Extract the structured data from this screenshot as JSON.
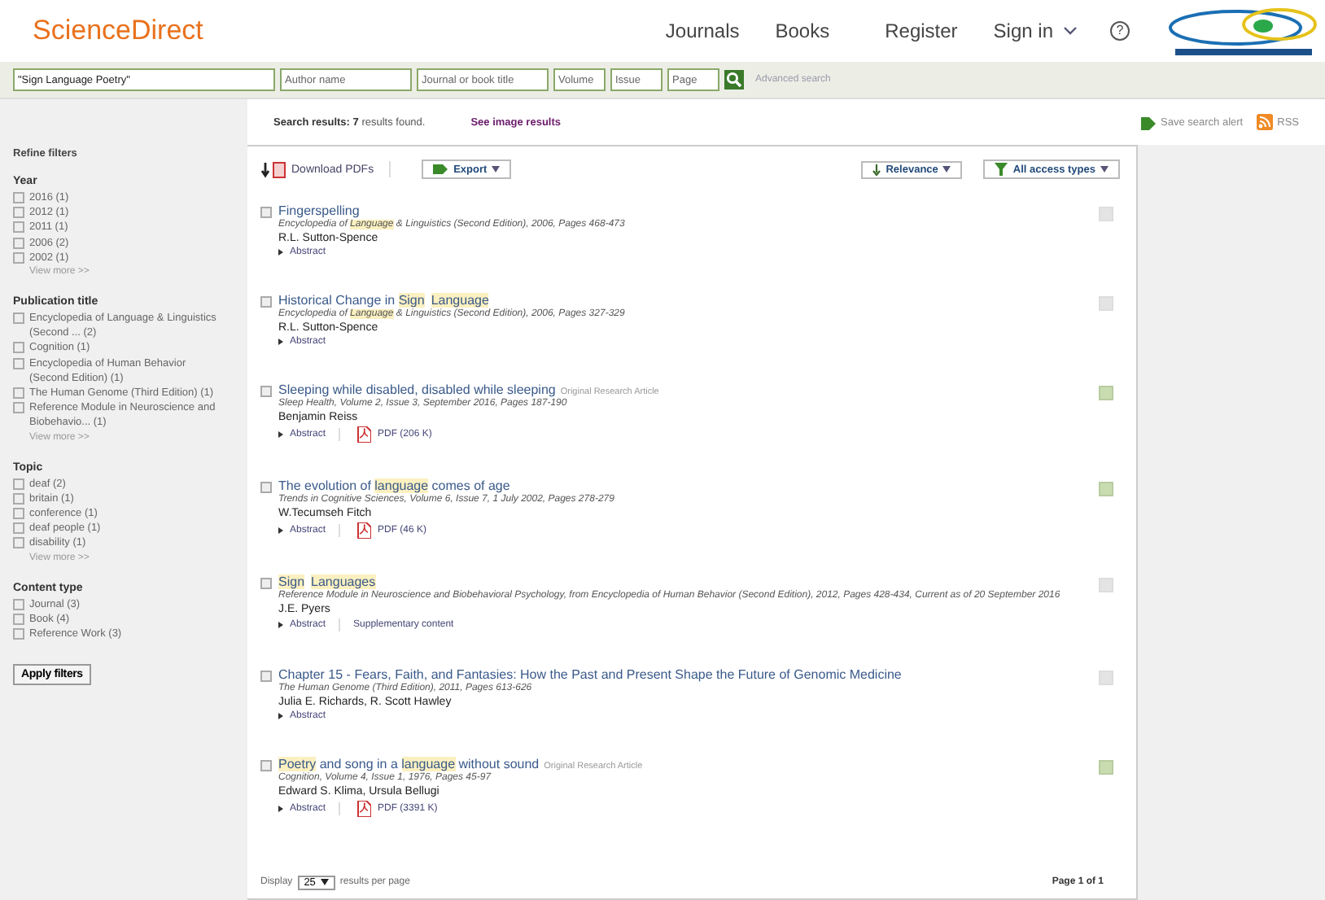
{
  "header": {
    "brand": "ScienceDirect",
    "nav": [
      "Journals",
      "Books"
    ],
    "register": "Register",
    "sign_in": "Sign in",
    "help": "?"
  },
  "search": {
    "fields": [
      {
        "kind": "terms",
        "value": "\"Sign Language Poetry\""
      },
      {
        "kind": "author",
        "placeholder": "Author name"
      },
      {
        "kind": "source",
        "placeholder": "Journal or book title"
      },
      {
        "kind": "small",
        "placeholder": "Volume"
      },
      {
        "kind": "small",
        "placeholder": "Issue"
      },
      {
        "kind": "small",
        "placeholder": "Page"
      }
    ],
    "advanced": "Advanced search"
  },
  "summary": {
    "label": "Search results:",
    "count": "7",
    "suffix": "results found.",
    "image_link": "See image results"
  },
  "alerts": {
    "save": "Save search alert",
    "rss": "RSS"
  },
  "filters": {
    "title": "Refine filters",
    "groups": [
      {
        "title": "Year",
        "items": [
          {
            "label": "2016 (1)",
            "checked": false
          },
          {
            "label": "2012 (1)",
            "checked": false
          },
          {
            "label": "2011 (1)",
            "checked": false
          },
          {
            "label": "2006 (2)",
            "checked": false
          },
          {
            "label": "2002 (1)",
            "checked": false
          }
        ],
        "more": "View more >>"
      },
      {
        "title": "Publication title",
        "items": [
          {
            "label": "Encyclopedia of Language & Linguistics (Second ... (2)",
            "checked": false
          },
          {
            "label": "Cognition (1)",
            "checked": false
          },
          {
            "label": "Encyclopedia of Human Behavior (Second Edition) (1)",
            "checked": false
          },
          {
            "label": "The Human Genome (Third Edition) (1)",
            "checked": false
          },
          {
            "label": "Reference Module in Neuroscience and Biobehavio... (1)",
            "checked": false
          }
        ],
        "more": "View more >>"
      },
      {
        "title": "Topic",
        "items": [
          {
            "label": "deaf (2)",
            "checked": false
          },
          {
            "label": "britain (1)",
            "checked": false
          },
          {
            "label": "conference (1)",
            "checked": false
          },
          {
            "label": "deaf people (1)",
            "checked": false
          },
          {
            "label": "disability (1)",
            "checked": false
          }
        ],
        "more": "View more >>"
      },
      {
        "title": "Content type",
        "items": [
          {
            "label": "Journal (3)",
            "checked": false
          },
          {
            "label": "Book (4)",
            "checked": false
          },
          {
            "label": "Reference Work (3)",
            "checked": false
          }
        ]
      }
    ],
    "apply": "Apply filters"
  },
  "toolbar": {
    "download": "Download PDFs",
    "export": "Export",
    "sort": "Relevance",
    "access": "All access types"
  },
  "results": [
    {
      "title": [
        {
          "text": "Fingerspelling",
          "highlight": false
        }
      ],
      "source": [
        {
          "text": "Encyclopedia of ",
          "highlight": false
        },
        {
          "text": "Language",
          "highlight": true
        },
        {
          "text": " & Linguistics (Second Edition), 2006, Pages 468-473",
          "highlight": false
        }
      ],
      "authors": "R.L. Sutton-Spence",
      "links": [
        {
          "kind": "abstract",
          "label": "Abstract"
        }
      ],
      "open_access": false,
      "checked": false
    },
    {
      "title": [
        {
          "text": "Historical Change in ",
          "highlight": false
        },
        {
          "text": "Sign",
          "highlight": true
        },
        {
          "text": "Language",
          "highlight": true
        }
      ],
      "source": [
        {
          "text": "Encyclopedia of ",
          "highlight": false
        },
        {
          "text": "Language",
          "highlight": true
        },
        {
          "text": " & Linguistics (Second Edition), 2006, Pages 327-329",
          "highlight": false
        }
      ],
      "authors": "R.L. Sutton-Spence",
      "links": [
        {
          "kind": "abstract",
          "label": "Abstract"
        }
      ],
      "open_access": false,
      "checked": false
    },
    {
      "title": [
        {
          "text": "Sleeping while disabled, disabled while sleeping",
          "highlight": false
        }
      ],
      "type": "Original Research Article",
      "source": [
        {
          "text": "Sleep Health, Volume 2, Issue 3, September 2016, Pages 187-190",
          "highlight": false
        }
      ],
      "authors": "Benjamin Reiss",
      "links": [
        {
          "kind": "abstract",
          "label": "Abstract"
        },
        {
          "kind": "pdf",
          "label": "PDF (206 K)"
        }
      ],
      "open_access": true,
      "checked": false
    },
    {
      "title": [
        {
          "text": "The evolution of ",
          "highlight": false
        },
        {
          "text": "language",
          "highlight": true
        },
        {
          "text": " comes of age",
          "highlight": false
        }
      ],
      "source": [
        {
          "text": "Trends in Cognitive Sciences, Volume 6, Issue 7, 1 July 2002, Pages 278-279",
          "highlight": false
        }
      ],
      "authors": "W.Tecumseh Fitch",
      "links": [
        {
          "kind": "abstract",
          "label": "Abstract"
        },
        {
          "kind": "pdf",
          "label": "PDF (46 K)"
        }
      ],
      "open_access": true,
      "checked": false
    },
    {
      "title": [
        {
          "text": "Sign",
          "highlight": true
        },
        {
          "text": "Languages",
          "highlight": true
        }
      ],
      "source": [
        {
          "text": "Reference Module in Neuroscience and Biobehavioral Psychology, from Encyclopedia of Human Behavior (Second Edition), 2012, Pages 428-434, Current as of 20 September 2016",
          "highlight": false
        }
      ],
      "authors": "J.E. Pyers",
      "links": [
        {
          "kind": "abstract",
          "label": "Abstract"
        },
        {
          "kind": "supplementary",
          "label": "Supplementary content"
        }
      ],
      "open_access": false,
      "checked": false
    },
    {
      "title": [
        {
          "text": "Chapter 15 - Fears, Faith, and Fantasies: How the Past and Present Shape the Future of Genomic Medicine",
          "highlight": false
        }
      ],
      "source": [
        {
          "text": "The Human Genome (Third Edition), 2011, Pages 613-626",
          "highlight": false
        }
      ],
      "authors": "Julia E. Richards, R. Scott Hawley",
      "links": [
        {
          "kind": "abstract",
          "label": "Abstract"
        }
      ],
      "open_access": false,
      "checked": false
    },
    {
      "title": [
        {
          "text": "Poetry",
          "highlight": true
        },
        {
          "text": " and song in a ",
          "highlight": false
        },
        {
          "text": "language",
          "highlight": true
        },
        {
          "text": " without sound",
          "highlight": false
        }
      ],
      "type": "Original Research Article",
      "source": [
        {
          "text": "Cognition, Volume 4, Issue 1, 1976, Pages 45-97",
          "highlight": false
        }
      ],
      "authors": "Edward S. Klima, Ursula Bellugi",
      "links": [
        {
          "kind": "abstract",
          "label": "Abstract"
        },
        {
          "kind": "pdf",
          "label": "PDF (3391 K)"
        }
      ],
      "open_access": true,
      "checked": false
    }
  ],
  "footer": {
    "display": "Display",
    "per_page": "25",
    "per_page_suffix": "results per page",
    "page": "Page 1 of 1"
  }
}
